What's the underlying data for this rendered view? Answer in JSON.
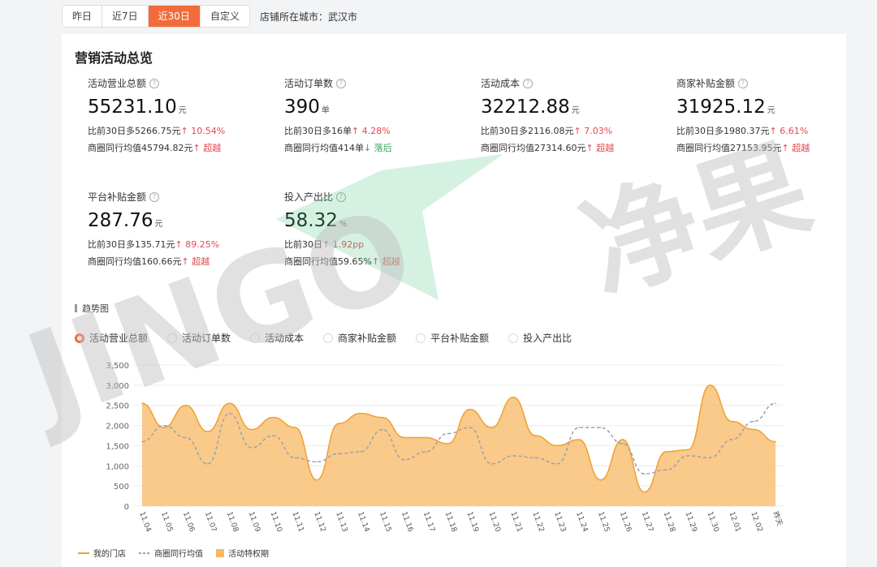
{
  "date_tabs": [
    {
      "label": "昨日",
      "active": false
    },
    {
      "label": "近7日",
      "active": false
    },
    {
      "label": "近30日",
      "active": true
    },
    {
      "label": "自定义",
      "active": false
    }
  ],
  "city": "店铺所在城市：武汉市",
  "card_title": "营销活动总览",
  "help_icon": "?",
  "metrics": [
    {
      "label": "活动营业总额",
      "value": "55231.10",
      "unit": "元",
      "cmp": "比前30日多5266.75元",
      "cmp_arrow": "↑",
      "cmp_pct": "10.54%",
      "bench": "商圈同行均值45794.82元",
      "bench_arrow": "↑",
      "bench_status": "超越",
      "bench_good": true
    },
    {
      "label": "活动订单数",
      "value": "390",
      "unit": "单",
      "cmp": "比前30日多16单",
      "cmp_arrow": "↑",
      "cmp_pct": "4.28%",
      "bench": "商圈同行均值414单",
      "bench_arrow": "↓",
      "bench_status": "落后",
      "bench_good": false
    },
    {
      "label": "活动成本",
      "value": "32212.88",
      "unit": "元",
      "cmp": "比前30日多2116.08元",
      "cmp_arrow": "↑",
      "cmp_pct": "7.03%",
      "bench": "商圈同行均值27314.60元",
      "bench_arrow": "↑",
      "bench_status": "超越",
      "bench_good": true
    },
    {
      "label": "商家补贴金额",
      "value": "31925.12",
      "unit": "元",
      "cmp": "比前30日多1980.37元",
      "cmp_arrow": "↑",
      "cmp_pct": "6.61%",
      "bench": "商圈同行均值27153.95元",
      "bench_arrow": "↑",
      "bench_status": "超越",
      "bench_good": true
    },
    {
      "label": "平台补贴金额",
      "value": "287.76",
      "unit": "元",
      "cmp": "比前30日多135.71元",
      "cmp_arrow": "↑",
      "cmp_pct": "89.25%",
      "bench": "商圈同行均值160.66元",
      "bench_arrow": "↑",
      "bench_status": "超越",
      "bench_good": true
    },
    {
      "label": "投入产出比",
      "value": "58.32",
      "unit": "%",
      "cmp": "比前30日",
      "cmp_arrow": "↑",
      "cmp_pct": "1.92pp",
      "bench": "商圈同行均值59.65%",
      "bench_arrow": "↑",
      "bench_status": "超越",
      "bench_good": true
    }
  ],
  "trend_title": "趋势图",
  "radio_options": [
    {
      "label": "活动营业总额",
      "selected": true
    },
    {
      "label": "活动订单数",
      "selected": false
    },
    {
      "label": "活动成本",
      "selected": false
    },
    {
      "label": "商家补贴金额",
      "selected": false
    },
    {
      "label": "平台补贴金额",
      "selected": false
    },
    {
      "label": "投入产出比",
      "selected": false
    }
  ],
  "watermark": {
    "latin": "JINGO",
    "cjk": "净果"
  },
  "chart_data": {
    "type": "area",
    "categories": [
      "11.04",
      "11.05",
      "11.06",
      "11.07",
      "11.08",
      "11.09",
      "11.10",
      "11.11",
      "11.12",
      "11.13",
      "11.14",
      "11.15",
      "11.16",
      "11.17",
      "11.18",
      "11.19",
      "11.20",
      "11.21",
      "11.22",
      "11.23",
      "11.24",
      "11.25",
      "11.26",
      "11.27",
      "11.28",
      "11.29",
      "11.30",
      "12.01",
      "12.02",
      "昨天"
    ],
    "yticks": [
      0,
      500,
      1000,
      1500,
      2000,
      2500,
      3000,
      3500
    ],
    "ytick_labels": [
      "0",
      "500",
      "1,000",
      "1,500",
      "2,000",
      "2,500",
      "3,000",
      "3,500"
    ],
    "ylim": [
      0,
      3500
    ],
    "grid": true,
    "legend_position": "bottom-left",
    "series": [
      {
        "name": "我的门店",
        "style": "line",
        "color": "#f0a030",
        "values": [
          2550,
          1950,
          2500,
          1850,
          2550,
          1900,
          2200,
          1950,
          650,
          2050,
          2300,
          2200,
          1700,
          1700,
          1550,
          2400,
          1950,
          2700,
          1750,
          1500,
          1650,
          650,
          1650,
          350,
          1350,
          1400,
          3000,
          2100,
          1900,
          1600
        ]
      },
      {
        "name": "商圈同行均值",
        "style": "dashed",
        "color": "#9aa0b4",
        "values": [
          1600,
          2000,
          1700,
          1050,
          2300,
          1450,
          1750,
          1200,
          1100,
          1300,
          1350,
          1900,
          1150,
          1350,
          1800,
          1950,
          1050,
          1250,
          1200,
          1050,
          1950,
          1950,
          1550,
          800,
          900,
          1250,
          1200,
          1650,
          2100,
          2550
        ]
      },
      {
        "name": "活动特权期",
        "style": "area",
        "color": "#f7b862",
        "values": []
      }
    ]
  }
}
